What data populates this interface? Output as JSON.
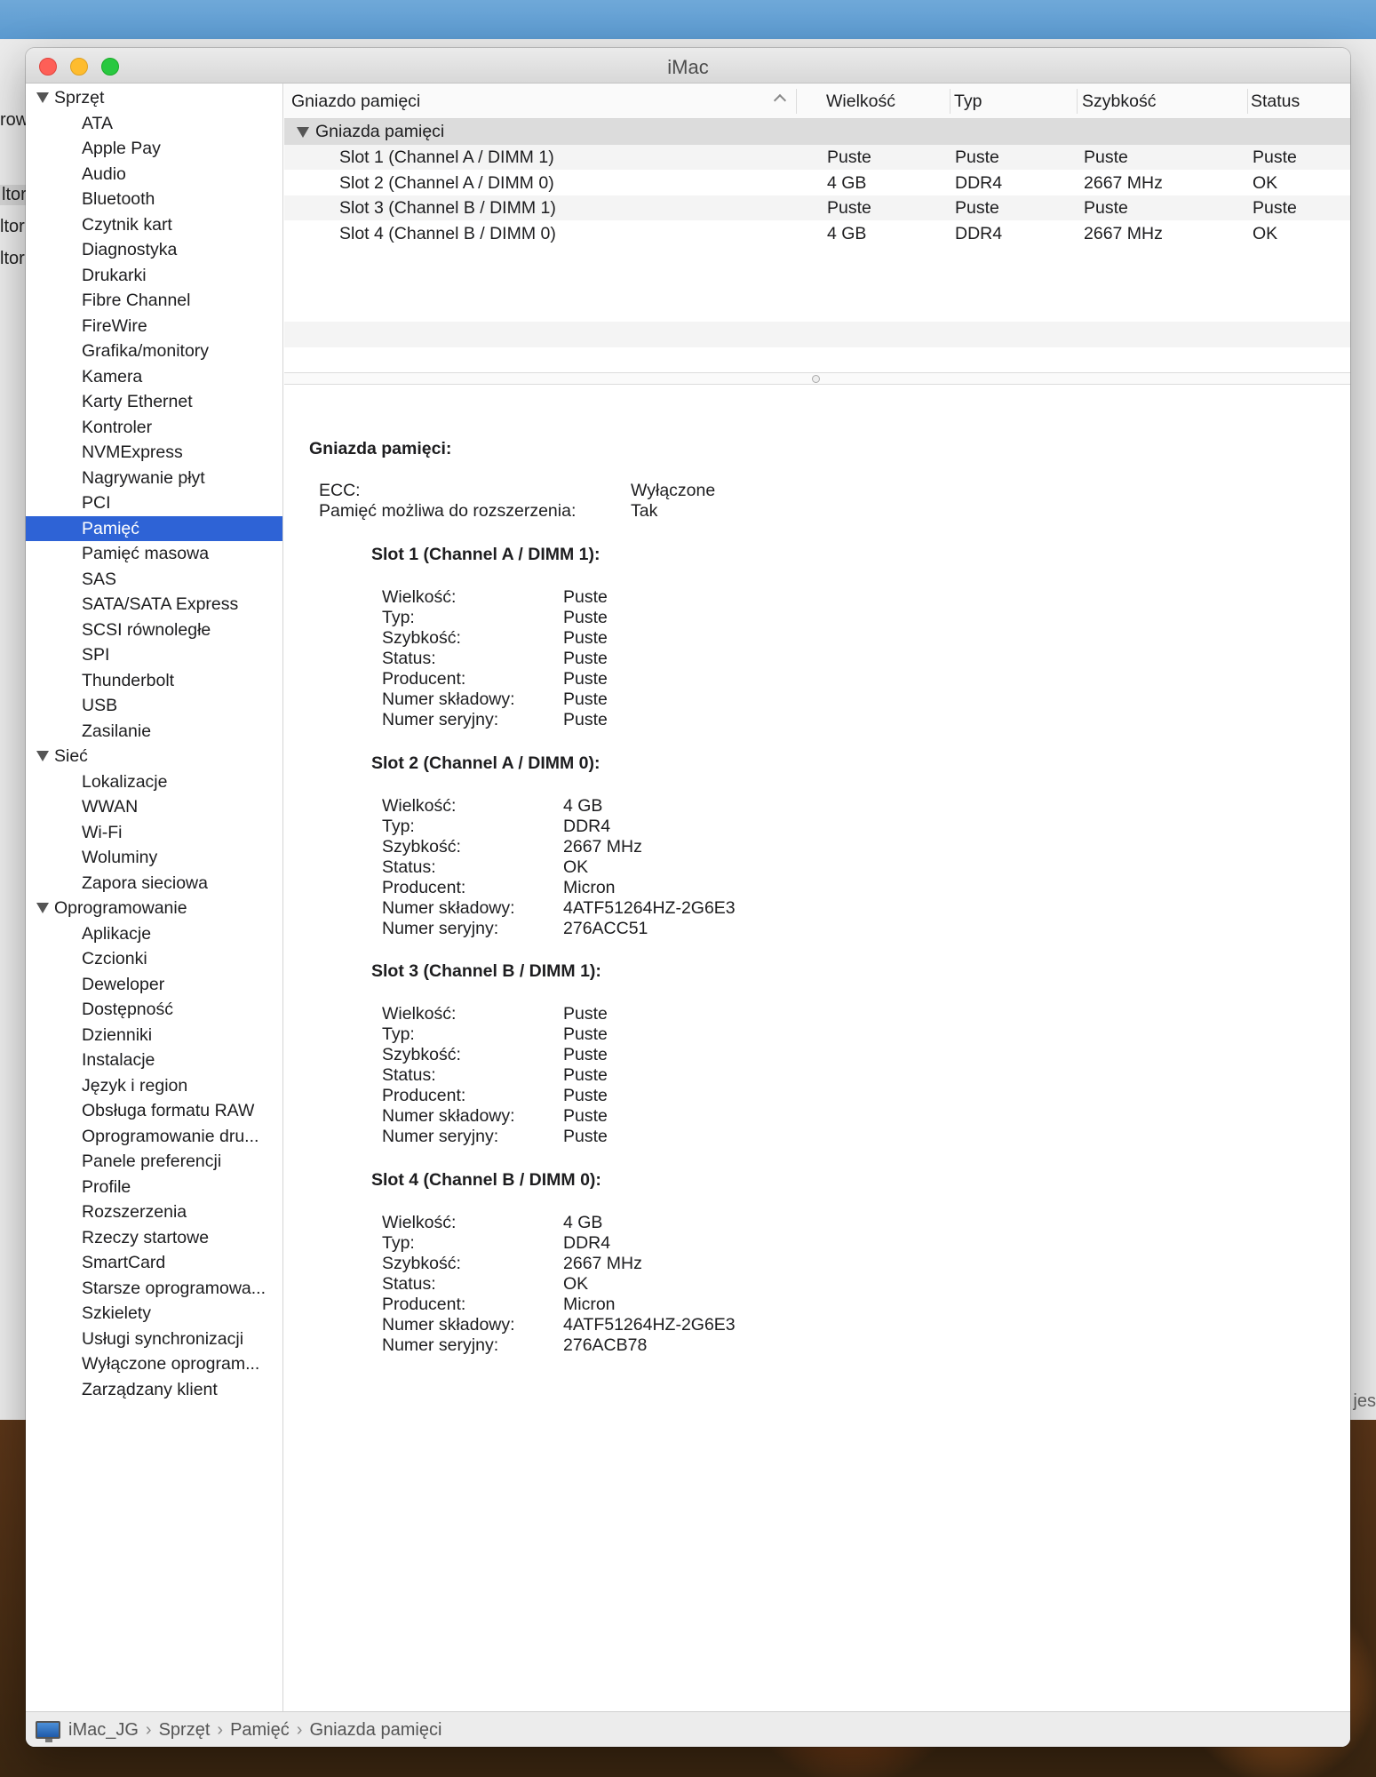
{
  "window": {
    "title": "iMac"
  },
  "background": {
    "back_labels": [
      "row",
      "ltor",
      "ltor",
      "ltor"
    ],
    "back_right_text": "jes"
  },
  "sidebar": {
    "sections": [
      {
        "label": "Sprzęt",
        "items": [
          "ATA",
          "Apple Pay",
          "Audio",
          "Bluetooth",
          "Czytnik kart",
          "Diagnostyka",
          "Drukarki",
          "Fibre Channel",
          "FireWire",
          "Grafika/monitory",
          "Kamera",
          "Karty Ethernet",
          "Kontroler",
          "NVMExpress",
          "Nagrywanie płyt",
          "PCI",
          "Pamięć",
          "Pamięć masowa",
          "SAS",
          "SATA/SATA Express",
          "SCSI równoległe",
          "SPI",
          "Thunderbolt",
          "USB",
          "Zasilanie"
        ]
      },
      {
        "label": "Sieć",
        "items": [
          "Lokalizacje",
          "WWAN",
          "Wi-Fi",
          "Woluminy",
          "Zapora sieciowa"
        ]
      },
      {
        "label": "Oprogramowanie",
        "items": [
          "Aplikacje",
          "Czcionki",
          "Deweloper",
          "Dostępność",
          "Dzienniki",
          "Instalacje",
          "Język i region",
          "Obsługa formatu RAW",
          "Oprogramowanie dru...",
          "Panele preferencji",
          "Profile",
          "Rozszerzenia",
          "Rzeczy startowe",
          "SmartCard",
          "Starsze oprogramowa...",
          "Szkielety",
          "Usługi synchronizacji",
          "Wyłączone oprogram...",
          "Zarządzany klient"
        ]
      }
    ],
    "selected": "Pamięć"
  },
  "table": {
    "columns": [
      "Gniazdo pamięci",
      "Wielkość",
      "Typ",
      "Szybkość",
      "Status"
    ],
    "group": "Gniazda pamięci",
    "rows": [
      [
        "Slot 1 (Channel A / DIMM 1)",
        "Puste",
        "Puste",
        "Puste",
        "Puste"
      ],
      [
        "Slot 2 (Channel A / DIMM 0)",
        "4  GB",
        "DDR4",
        "2667 MHz",
        "OK"
      ],
      [
        "Slot 3 (Channel B / DIMM 1)",
        "Puste",
        "Puste",
        "Puste",
        "Puste"
      ],
      [
        "Slot 4 (Channel B / DIMM 0)",
        "4  GB",
        "DDR4",
        "2667 MHz",
        "OK"
      ]
    ]
  },
  "detail": {
    "title": "Gniazda pamięci:",
    "general": [
      {
        "key": "ECC:",
        "value": "Wyłączone"
      },
      {
        "key": "Pamięć możliwa do rozszerzenia:",
        "value": "Tak"
      }
    ],
    "slots": [
      {
        "title": "Slot 1 (Channel A / DIMM 1):",
        "fields": [
          {
            "key": "Wielkość:",
            "value": "Puste"
          },
          {
            "key": "Typ:",
            "value": "Puste"
          },
          {
            "key": "Szybkość:",
            "value": "Puste"
          },
          {
            "key": "Status:",
            "value": "Puste"
          },
          {
            "key": "Producent:",
            "value": "Puste"
          },
          {
            "key": "Numer składowy:",
            "value": "Puste"
          },
          {
            "key": "Numer seryjny:",
            "value": "Puste"
          }
        ]
      },
      {
        "title": "Slot 2 (Channel A / DIMM 0):",
        "fields": [
          {
            "key": "Wielkość:",
            "value": "4  GB"
          },
          {
            "key": "Typ:",
            "value": "DDR4"
          },
          {
            "key": "Szybkość:",
            "value": "2667 MHz"
          },
          {
            "key": "Status:",
            "value": "OK"
          },
          {
            "key": "Producent:",
            "value": "Micron"
          },
          {
            "key": "Numer składowy:",
            "value": "4ATF51264HZ-2G6E3"
          },
          {
            "key": "Numer seryjny:",
            "value": "276ACC51"
          }
        ]
      },
      {
        "title": "Slot 3 (Channel B / DIMM 1):",
        "fields": [
          {
            "key": "Wielkość:",
            "value": "Puste"
          },
          {
            "key": "Typ:",
            "value": "Puste"
          },
          {
            "key": "Szybkość:",
            "value": "Puste"
          },
          {
            "key": "Status:",
            "value": "Puste"
          },
          {
            "key": "Producent:",
            "value": "Puste"
          },
          {
            "key": "Numer składowy:",
            "value": "Puste"
          },
          {
            "key": "Numer seryjny:",
            "value": "Puste"
          }
        ]
      },
      {
        "title": "Slot 4 (Channel B / DIMM 0):",
        "fields": [
          {
            "key": "Wielkość:",
            "value": "4  GB"
          },
          {
            "key": "Typ:",
            "value": "DDR4"
          },
          {
            "key": "Szybkość:",
            "value": "2667 MHz"
          },
          {
            "key": "Status:",
            "value": "OK"
          },
          {
            "key": "Producent:",
            "value": "Micron"
          },
          {
            "key": "Numer składowy:",
            "value": "4ATF51264HZ-2G6E3"
          },
          {
            "key": "Numer seryjny:",
            "value": "276ACB78"
          }
        ]
      }
    ]
  },
  "statusbar": {
    "icon": "imac-icon",
    "breadcrumb": [
      "iMac_JG",
      "Sprzęt",
      "Pamięć",
      "Gniazda pamięci"
    ],
    "separator": "›"
  }
}
